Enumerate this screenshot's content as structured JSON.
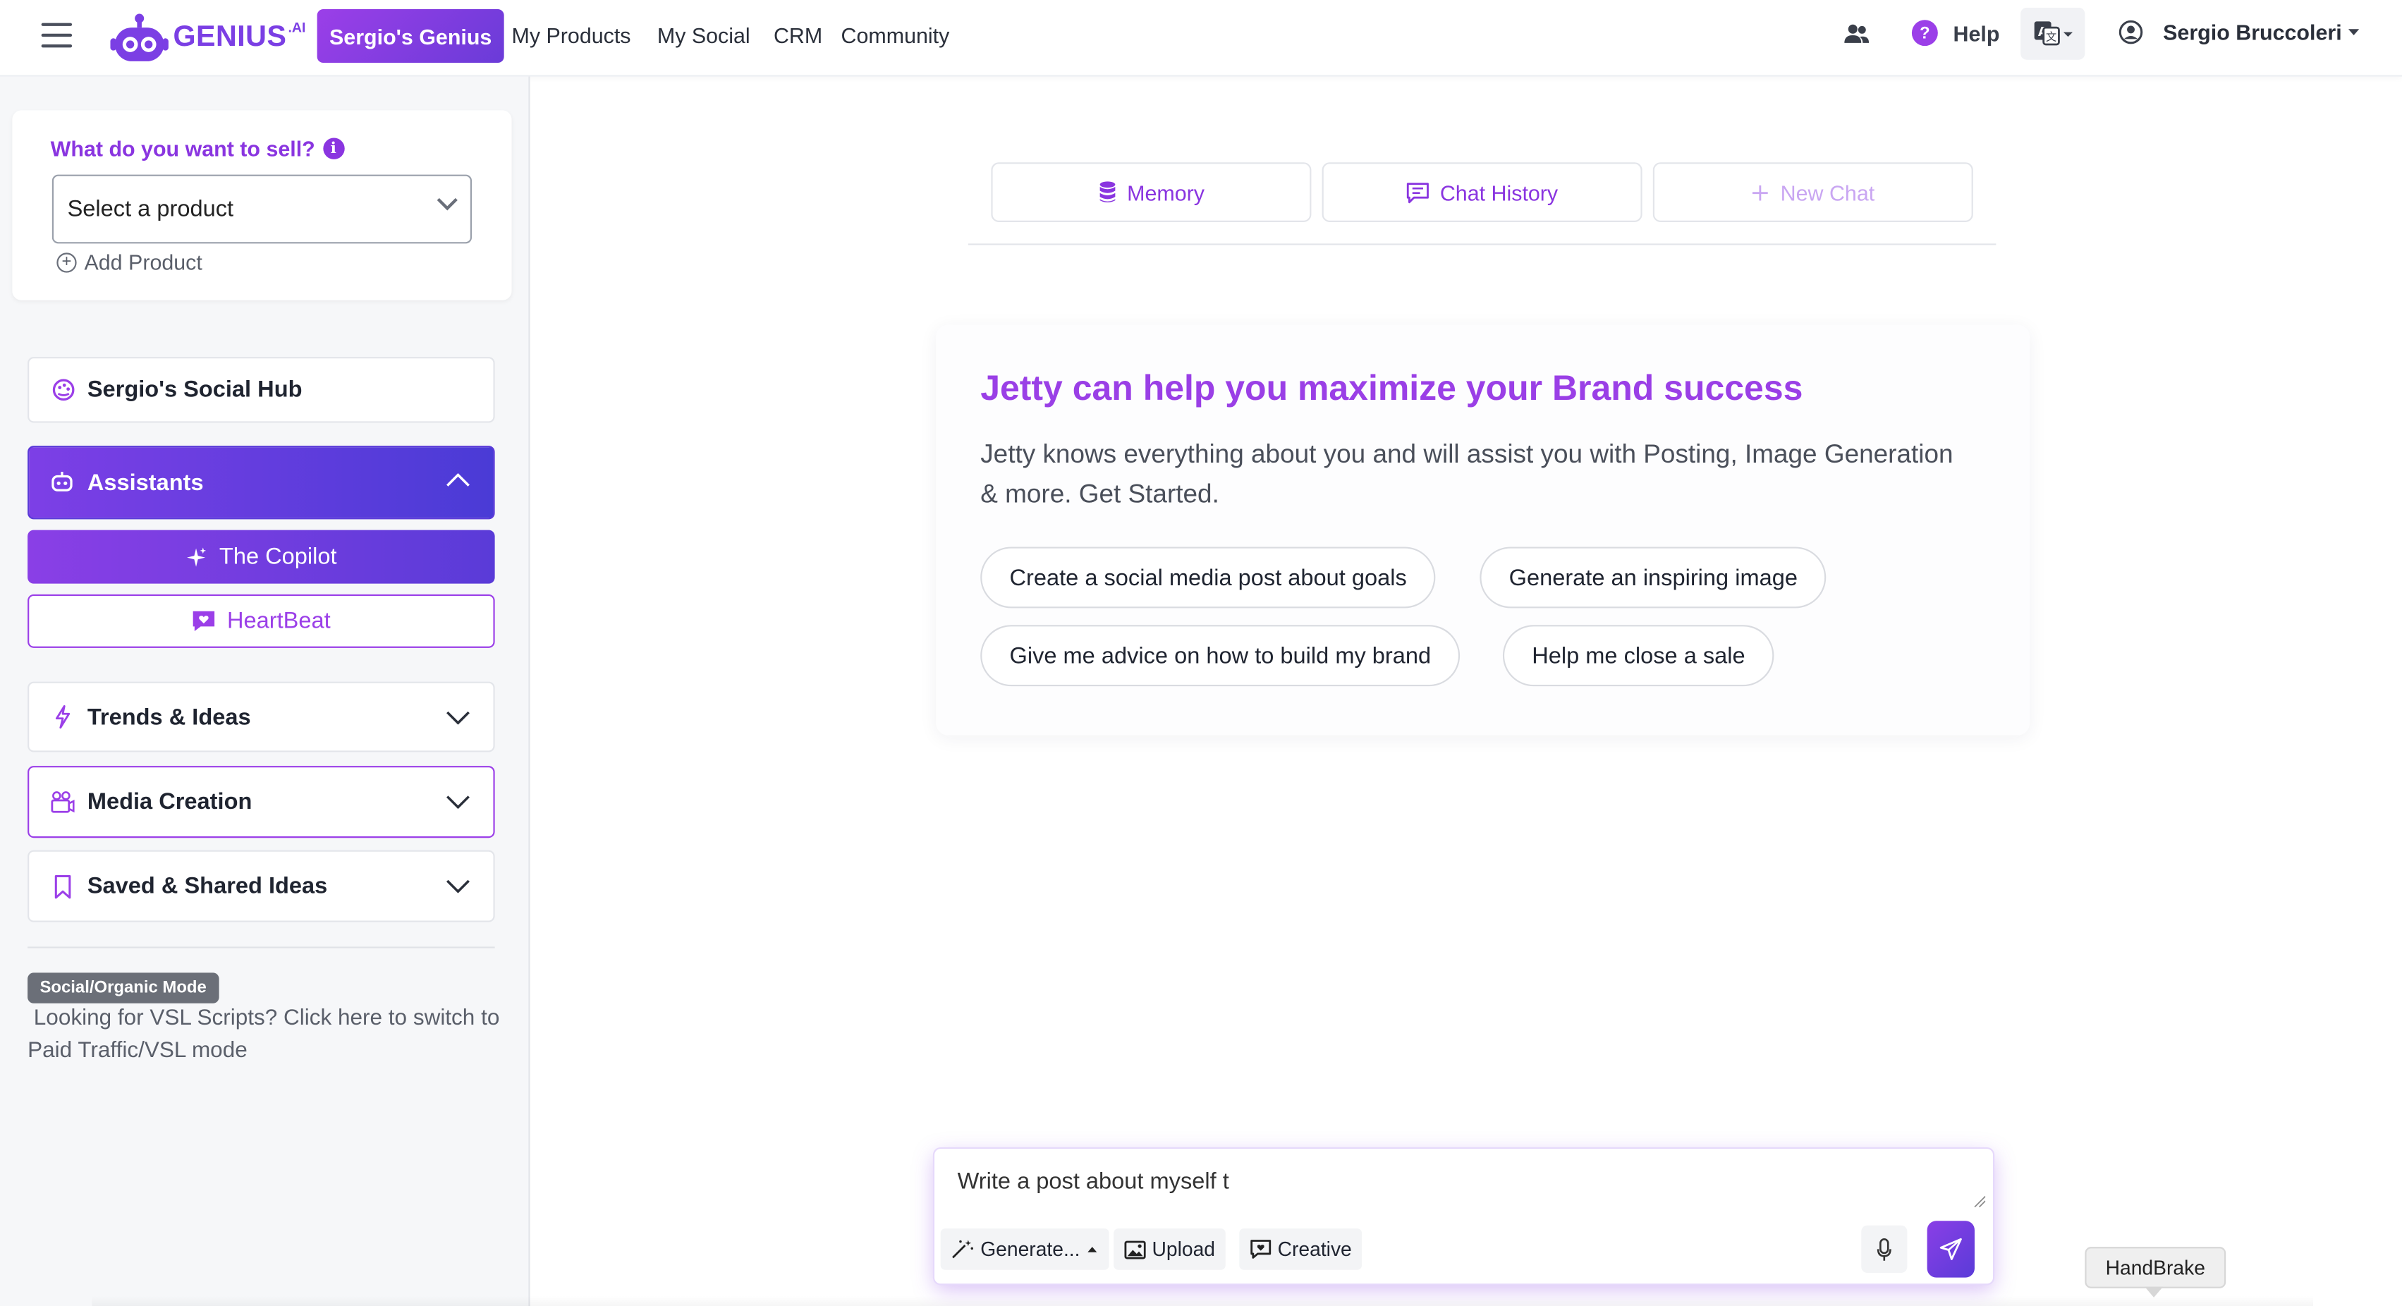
{
  "nav": {
    "logo_text": "GENIUS",
    "logo_sup": ".AI",
    "active_tab": "Sergio's Genius",
    "links": [
      "My Products",
      "My Social",
      "CRM",
      "Community"
    ],
    "help": "Help",
    "user_name": "Sergio Bruccoleri"
  },
  "sidebar": {
    "sell_label": "What do you want to sell?",
    "info_glyph": "i",
    "select_placeholder": "Select a product",
    "add_product": "Add Product",
    "social_hub": "Sergio's Social Hub",
    "assistants": "Assistants",
    "copilot": "The Copilot",
    "heartbeat": "HeartBeat",
    "trends": "Trends & Ideas",
    "media": "Media Creation",
    "saved": "Saved & Shared Ideas",
    "mode_badge": "Social/Organic Mode",
    "vsl_text": "Looking for VSL Scripts? Click here to switch to Paid Traffic/VSL mode"
  },
  "main": {
    "memory": "Memory",
    "chat_history": "Chat History",
    "new_chat": "New Chat",
    "hero_title": "Jetty can help you maximize your Brand success",
    "hero_sub": "Jetty knows everything about you and will assist you with Posting, Image Generation & more. Get Started.",
    "chips": [
      "Create a social media post about goals",
      "Generate an inspiring image",
      "Give me advice on how to build my brand",
      "Help me close a sale"
    ]
  },
  "composer": {
    "value": "Write a post about myself t",
    "generate": "Generate...",
    "upload": "Upload",
    "creative": "Creative"
  },
  "tooltip": "HandBrake",
  "colors": {
    "brand_purple": "#9a3fe6",
    "brand_indigo": "#4a3bd6"
  }
}
